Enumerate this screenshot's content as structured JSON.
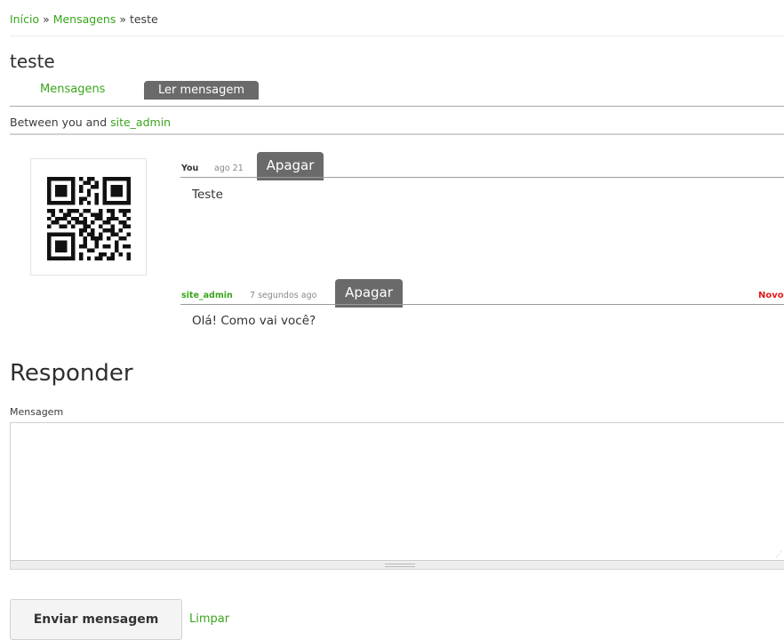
{
  "breadcrumb": {
    "home": "Início",
    "separator": "»",
    "messages": "Mensagens",
    "current": "teste"
  },
  "page": {
    "title": "teste"
  },
  "tabs": {
    "messages": "Mensagens",
    "read": "Ler mensagem"
  },
  "thread": {
    "between_prefix": "Between you and",
    "participant": "site_admin"
  },
  "messages": [
    {
      "author": "You",
      "time": "ago 21",
      "delete_label": "Apagar",
      "body": "Teste",
      "is_new": false
    },
    {
      "author": "site_admin",
      "time": "7 segundos ago",
      "delete_label": "Apagar",
      "body": "Olá! Como vai você?",
      "is_new": true,
      "new_label": "Novo"
    }
  ],
  "reply": {
    "title": "Responder",
    "field_label": "Mensagem",
    "value": "",
    "send_label": "Enviar mensagem",
    "clear_label": "Limpar"
  },
  "colors": {
    "link": "#3aa51c",
    "tab_active_bg": "#6a6a6a",
    "new_badge": "#e01b1b"
  },
  "icons": {
    "avatar": "qr-code-icon",
    "resize": "resize-grip-icon"
  }
}
